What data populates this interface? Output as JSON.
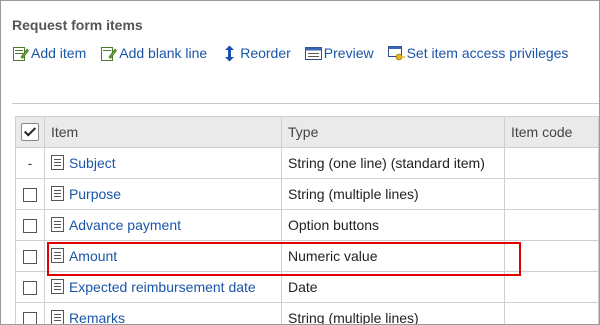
{
  "section_title": "Request form items",
  "toolbar": {
    "add_item": "Add item",
    "add_blank_line": "Add blank line",
    "reorder": "Reorder",
    "preview": "Preview",
    "access": "Set item access privileges"
  },
  "table": {
    "headers": {
      "item": "Item",
      "type": "Type",
      "code": "Item code"
    },
    "rows": [
      {
        "name": "Subject",
        "type": "String (one line) (standard item)",
        "code": "",
        "checkbox": "-"
      },
      {
        "name": "Purpose",
        "type": "String (multiple lines)",
        "code": "",
        "checkbox": "box"
      },
      {
        "name": "Advance payment",
        "type": "Option buttons",
        "code": "",
        "checkbox": "box"
      },
      {
        "name": "Amount",
        "type": "Numeric value",
        "code": "",
        "checkbox": "box"
      },
      {
        "name": "Expected reimbursement date",
        "type": "Date",
        "code": "",
        "checkbox": "box"
      },
      {
        "name": "Remarks",
        "type": "String (multiple lines)",
        "code": "",
        "checkbox": "box"
      }
    ]
  },
  "colors": {
    "link": "#1a55a8",
    "highlight": "#e00000",
    "header_bg": "#eaeaea"
  }
}
